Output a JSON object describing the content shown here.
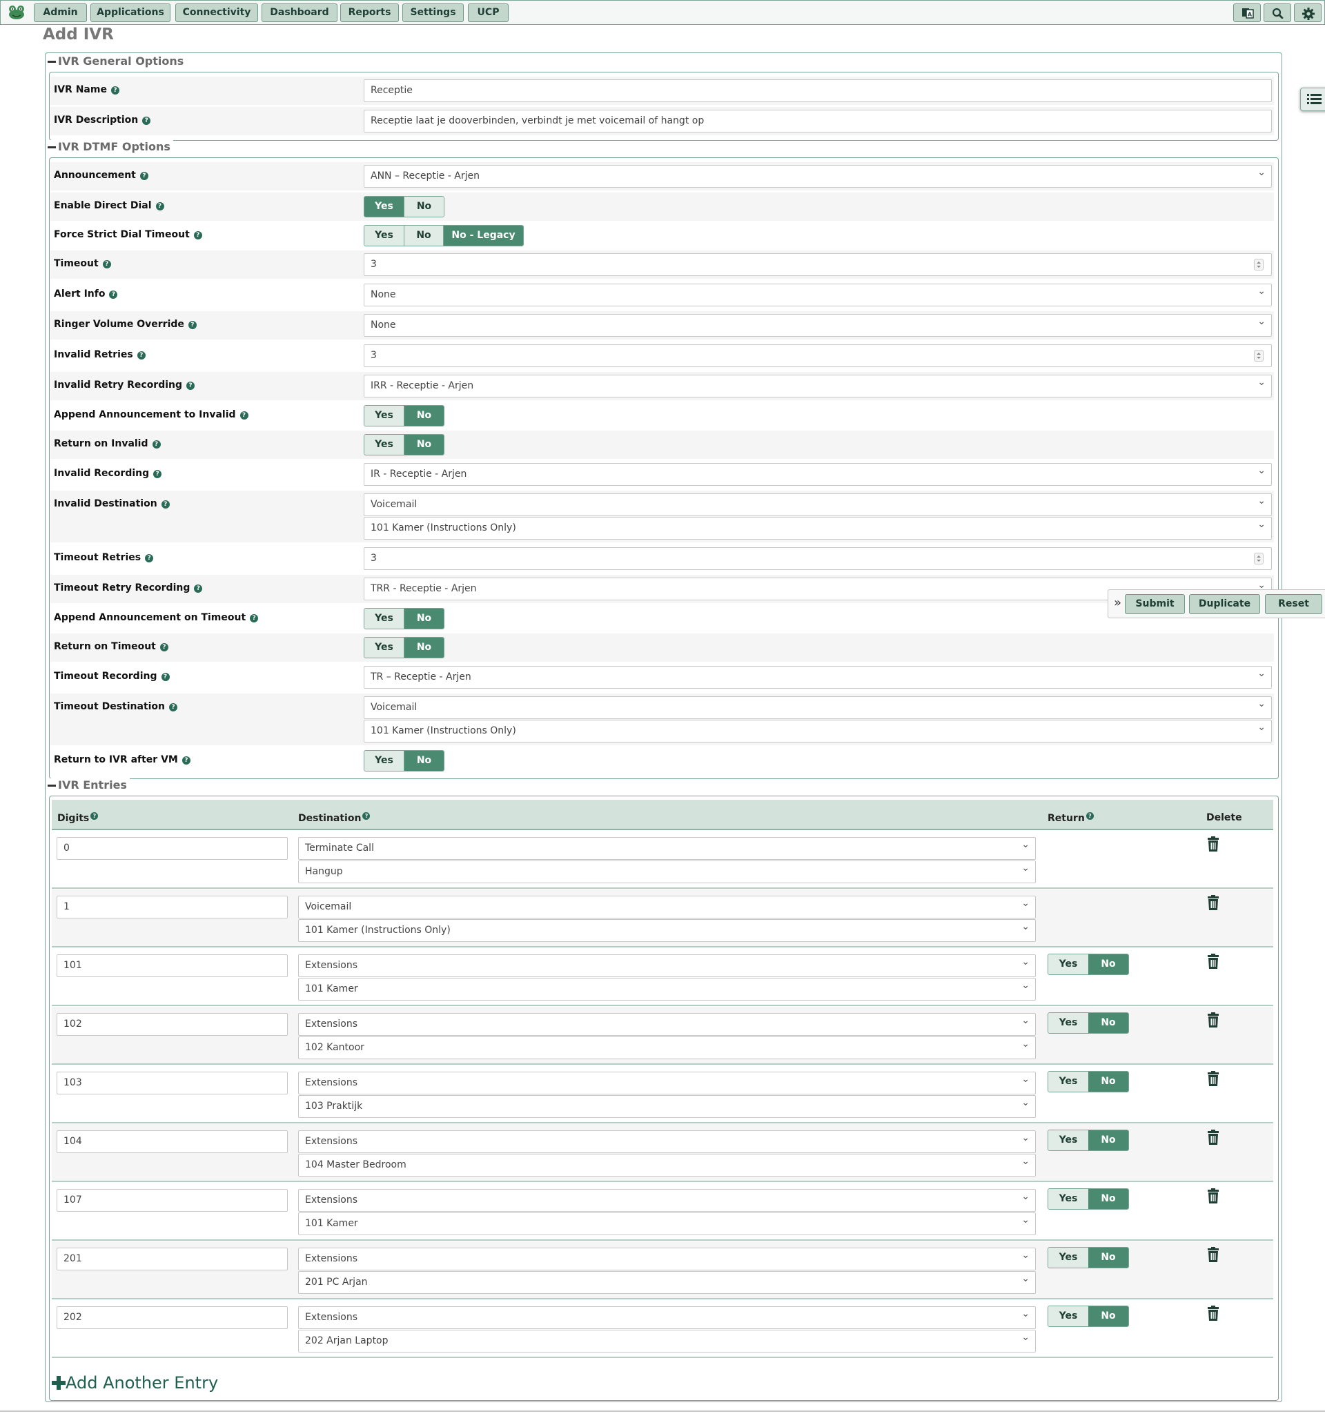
{
  "nav": {
    "logo_icon": "frog-logo-icon",
    "items": [
      {
        "label": "Admin"
      },
      {
        "label": "Applications"
      },
      {
        "label": "Connectivity"
      },
      {
        "label": "Dashboard"
      },
      {
        "label": "Reports"
      },
      {
        "label": "Settings"
      },
      {
        "label": "UCP"
      }
    ],
    "right_icons": [
      "language-icon",
      "search-icon",
      "gear-icon"
    ]
  },
  "page": {
    "title": "Add IVR"
  },
  "sections": {
    "general": "IVR General Options",
    "dtmf": "IVR DTMF Options",
    "entries": "IVR Entries"
  },
  "general": {
    "name_label": "IVR Name",
    "name_value": "Receptie",
    "desc_label": "IVR Description",
    "desc_value": "Receptie laat je dooverbinden, verbindt je met voicemail of hangt op"
  },
  "dtmf": {
    "announcement": {
      "label": "Announcement",
      "value": "ANN – Receptie - Arjen"
    },
    "direct_dial": {
      "label": "Enable Direct Dial",
      "options": [
        "Yes",
        "No"
      ],
      "selected": "Yes"
    },
    "strict_timeout": {
      "label": "Force Strict Dial Timeout",
      "options": [
        "Yes",
        "No",
        "No - Legacy"
      ],
      "selected": "No - Legacy"
    },
    "timeout": {
      "label": "Timeout",
      "value": "3"
    },
    "alert_info": {
      "label": "Alert Info",
      "value": "None"
    },
    "ringer_volume": {
      "label": "Ringer Volume Override",
      "value": "None"
    },
    "invalid_retries": {
      "label": "Invalid Retries",
      "value": "3"
    },
    "invalid_retry_recording": {
      "label": "Invalid Retry Recording",
      "value": "IRR - Receptie - Arjen"
    },
    "append_invalid": {
      "label": "Append Announcement to Invalid",
      "options": [
        "Yes",
        "No"
      ],
      "selected": "No"
    },
    "return_invalid": {
      "label": "Return on Invalid",
      "options": [
        "Yes",
        "No"
      ],
      "selected": "No"
    },
    "invalid_recording": {
      "label": "Invalid Recording",
      "value": "IR - Receptie - Arjen"
    },
    "invalid_destination": {
      "label": "Invalid Destination",
      "type": "Voicemail",
      "target": "101 Kamer (Instructions Only)"
    },
    "timeout_retries": {
      "label": "Timeout Retries",
      "value": "3"
    },
    "timeout_retry_recording": {
      "label": "Timeout Retry Recording",
      "value": "TRR - Receptie - Arjen"
    },
    "append_timeout": {
      "label": "Append Announcement on Timeout",
      "options": [
        "Yes",
        "No"
      ],
      "selected": "No"
    },
    "return_timeout": {
      "label": "Return on Timeout",
      "options": [
        "Yes",
        "No"
      ],
      "selected": "No"
    },
    "timeout_recording": {
      "label": "Timeout Recording",
      "value": "TR – Receptie - Arjen"
    },
    "timeout_destination": {
      "label": "Timeout Destination",
      "type": "Voicemail",
      "target": "101 Kamer (Instructions Only)"
    },
    "return_after_vm": {
      "label": "Return to IVR after VM",
      "options": [
        "Yes",
        "No"
      ],
      "selected": "No"
    }
  },
  "help_icon": "question-circle-icon",
  "actions": {
    "submit": "Submit",
    "duplicate": "Duplicate",
    "reset": "Reset",
    "expand_icon": "double-chevron-right-icon"
  },
  "entries": {
    "headers": {
      "digits": "Digits",
      "destination": "Destination",
      "return": "Return",
      "delete": "Delete"
    },
    "return_options": [
      "Yes",
      "No"
    ],
    "delete_icon": "trash-icon",
    "rows": [
      {
        "digits": "0",
        "type": "Terminate Call",
        "target": "Hangup",
        "has_return": false,
        "return": ""
      },
      {
        "digits": "1",
        "type": "Voicemail",
        "target": "101 Kamer (Instructions Only)",
        "has_return": false,
        "return": ""
      },
      {
        "digits": "101",
        "type": "Extensions",
        "target": "101 Kamer",
        "has_return": true,
        "return": "No"
      },
      {
        "digits": "102",
        "type": "Extensions",
        "target": "102 Kantoor",
        "has_return": true,
        "return": "No"
      },
      {
        "digits": "103",
        "type": "Extensions",
        "target": "103 Praktijk",
        "has_return": true,
        "return": "No"
      },
      {
        "digits": "104",
        "type": "Extensions",
        "target": "104 Master Bedroom",
        "has_return": true,
        "return": "No"
      },
      {
        "digits": "107",
        "type": "Extensions",
        "target": "101 Kamer",
        "has_return": true,
        "return": "No"
      },
      {
        "digits": "201",
        "type": "Extensions",
        "target": "201 PC Arjan",
        "has_return": true,
        "return": "No"
      },
      {
        "digits": "202",
        "type": "Extensions",
        "target": "202 Arjan Laptop",
        "has_return": true,
        "return": "No"
      }
    ],
    "add_label": "Add Another Entry",
    "add_icon": "plus-icon"
  },
  "side_toggle_icon": "list-icon"
}
